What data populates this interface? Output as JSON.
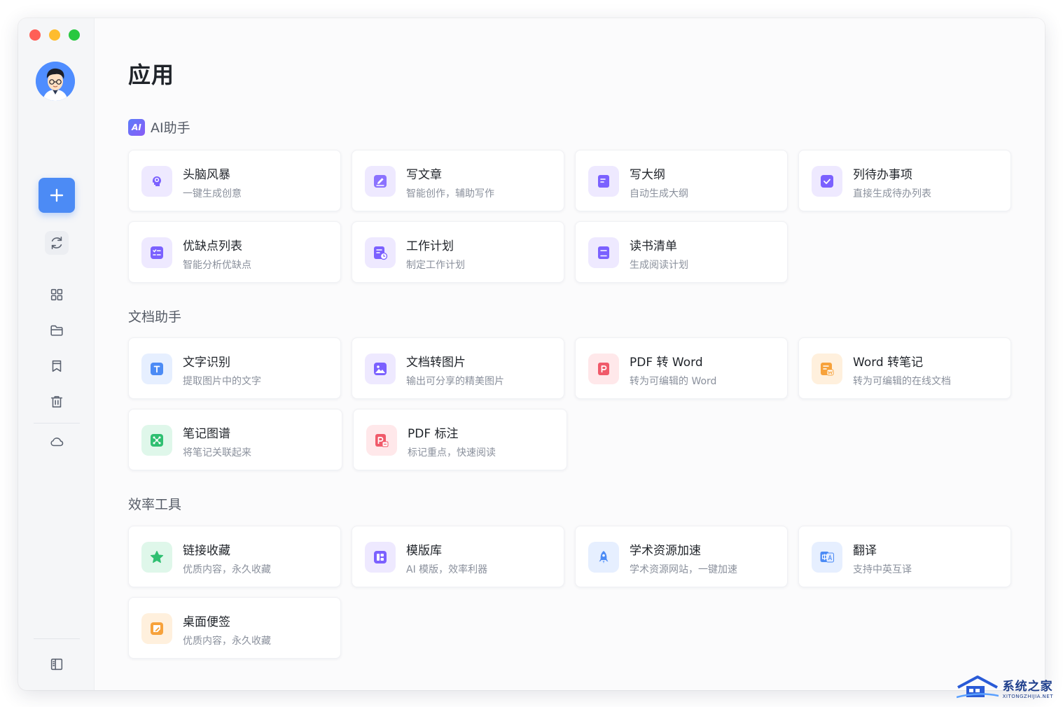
{
  "page": {
    "title": "应用"
  },
  "sidebar": {
    "icons": [
      "plus-icon",
      "sync-icon",
      "grid-icon",
      "folder-icon",
      "bookmark-icon",
      "trash-icon",
      "cloud-icon",
      "panel-toggle-icon"
    ]
  },
  "sections": [
    {
      "title": "AI助手",
      "badge": "AI",
      "cards": [
        {
          "title": "头脑风暴",
          "desc": "一键生成创意",
          "icon": "brain-icon",
          "color": "#7b61ff"
        },
        {
          "title": "写文章",
          "desc": "智能创作，辅助写作",
          "icon": "pen-icon",
          "color": "#7b61ff"
        },
        {
          "title": "写大纲",
          "desc": "自动生成大纲",
          "icon": "outline-icon",
          "color": "#7b61ff"
        },
        {
          "title": "列待办事项",
          "desc": "直接生成待办列表",
          "icon": "checkbox-icon",
          "color": "#7b61ff"
        },
        {
          "title": "优缺点列表",
          "desc": "智能分析优缺点",
          "icon": "checklist-icon",
          "color": "#7b61ff"
        },
        {
          "title": "工作计划",
          "desc": "制定工作计划",
          "icon": "plan-icon",
          "color": "#7b61ff"
        },
        {
          "title": "读书清单",
          "desc": "生成阅读计划",
          "icon": "book-icon",
          "color": "#7b61ff"
        }
      ]
    },
    {
      "title": "文档助手",
      "cards": [
        {
          "title": "文字识别",
          "desc": "提取图片中的文字",
          "icon": "ocr-icon",
          "color": "#4c8bf5"
        },
        {
          "title": "文档转图片",
          "desc": "输出可分享的精美图片",
          "icon": "image-icon",
          "color": "#7b61ff"
        },
        {
          "title": "PDF 转 Word",
          "desc": "转为可编辑的 Word",
          "icon": "pdf-icon",
          "color": "#f05a6a"
        },
        {
          "title": "Word 转笔记",
          "desc": "转为可编辑的在线文档",
          "icon": "word-icon",
          "color": "#f7a23b"
        },
        {
          "title": "笔记图谱",
          "desc": "将笔记关联起来",
          "icon": "graph-icon",
          "color": "#2fbf71"
        },
        {
          "title": "PDF 标注",
          "desc": "标记重点，快速阅读",
          "icon": "pdf-mark-icon",
          "color": "#f05a6a"
        }
      ]
    },
    {
      "title": "效率工具",
      "cards": [
        {
          "title": "链接收藏",
          "desc": "优质内容，永久收藏",
          "icon": "star-icon",
          "color": "#2fbf71"
        },
        {
          "title": "模版库",
          "desc": "AI 模版，效率利器",
          "icon": "template-icon",
          "color": "#7b61ff"
        },
        {
          "title": "学术资源加速",
          "desc": "学术资源网站，一键加速",
          "icon": "rocket-icon",
          "color": "#4c8bf5"
        },
        {
          "title": "翻译",
          "desc": "支持中英互译",
          "icon": "translate-icon",
          "color": "#4c8bf5"
        },
        {
          "title": "桌面便签",
          "desc": "优质内容，永久收藏",
          "icon": "sticky-note-icon",
          "color": "#f7a23b"
        }
      ]
    }
  ],
  "watermark": {
    "cn": "系统之家",
    "en": "XITONGZHIJIA.NET"
  }
}
